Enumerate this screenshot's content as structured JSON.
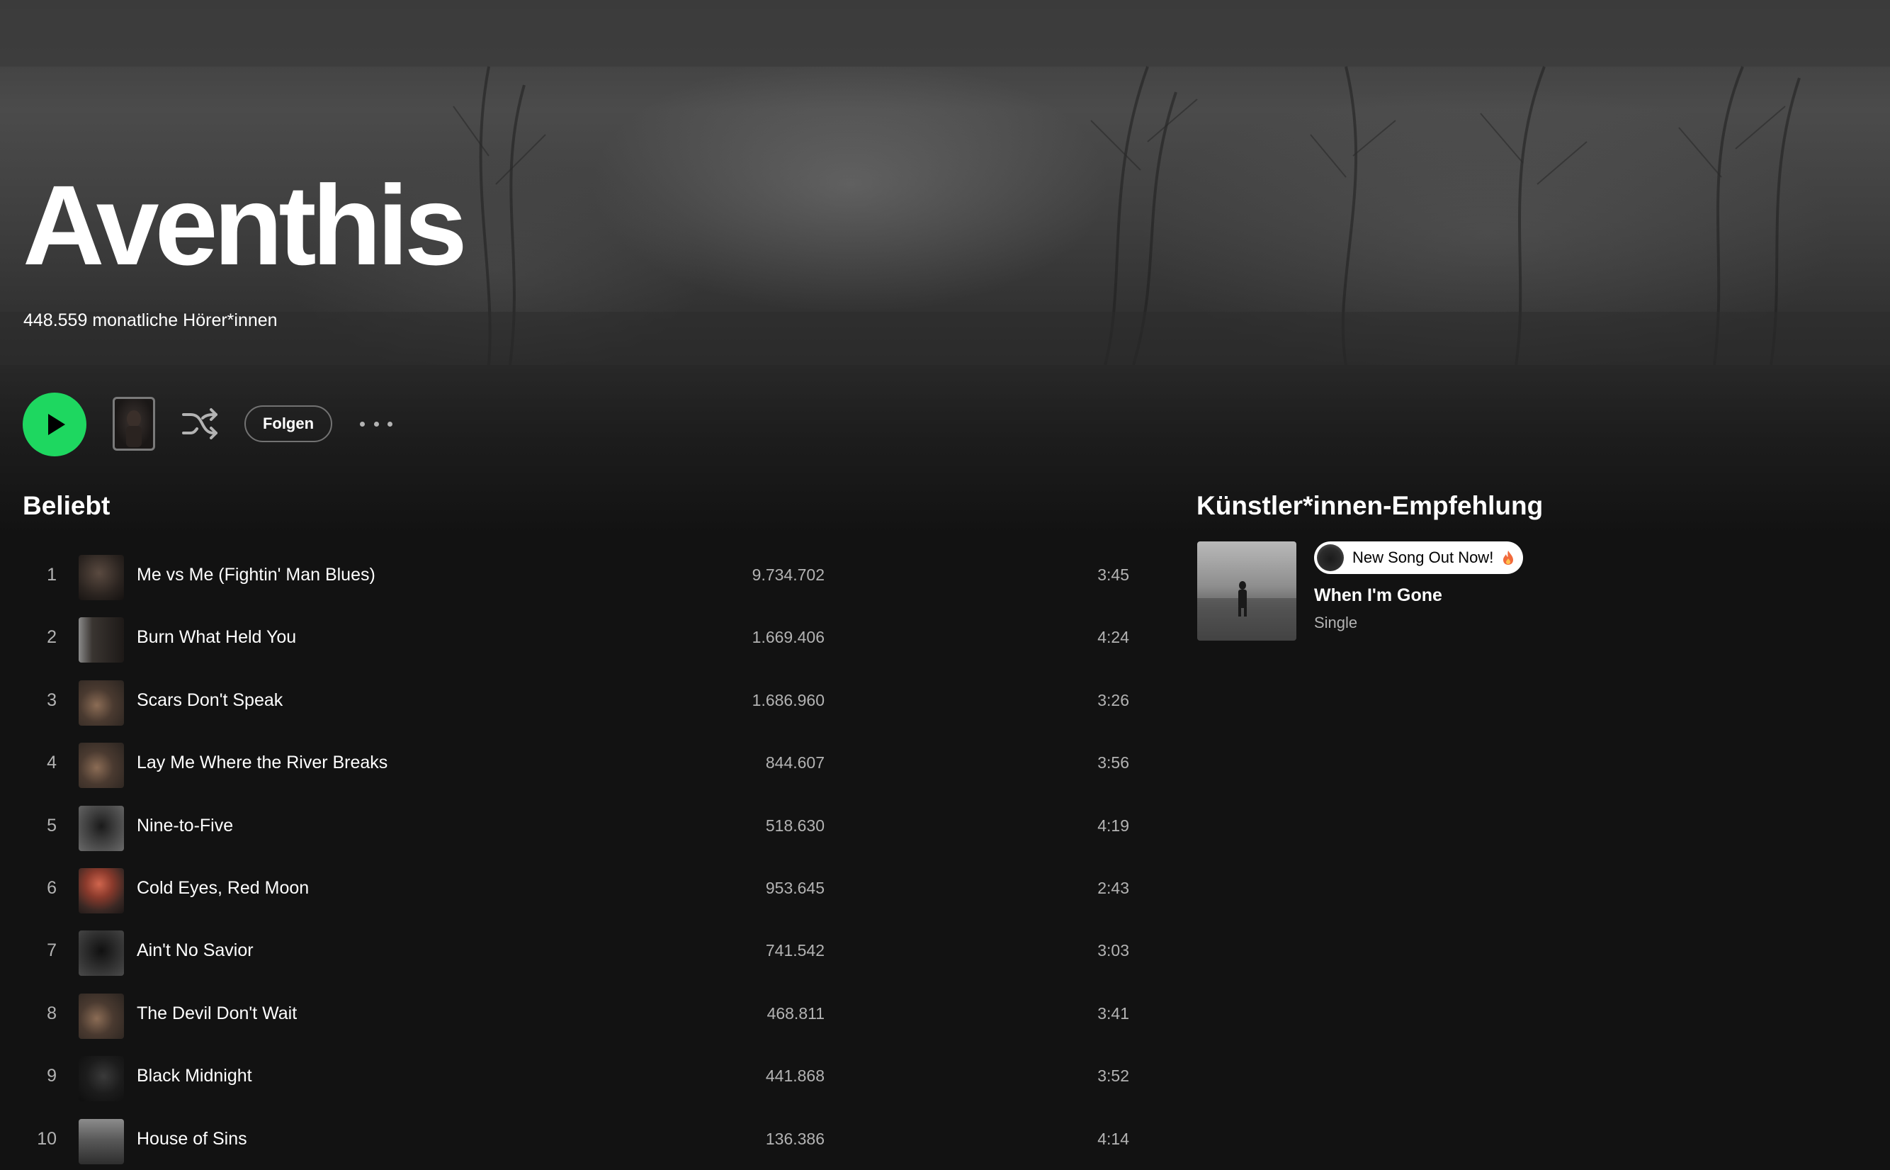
{
  "artist": {
    "name": "Aventhis",
    "monthly_listeners": "448.559 monatliche Hörer*innen"
  },
  "actions": {
    "play_label": "play-icon",
    "shuffle_icon": "shuffle-icon",
    "follow_label": "Folgen",
    "more_icon": "more-options-icon"
  },
  "popular": {
    "title": "Beliebt",
    "tracks": [
      {
        "num": "1",
        "title": "Me vs Me (Fightin' Man Blues)",
        "plays": "9.734.702",
        "duration": "3:45"
      },
      {
        "num": "2",
        "title": "Burn What Held You",
        "plays": "1.669.406",
        "duration": "4:24"
      },
      {
        "num": "3",
        "title": "Scars Don't Speak",
        "plays": "1.686.960",
        "duration": "3:26"
      },
      {
        "num": "4",
        "title": "Lay Me Where the River Breaks",
        "plays": "844.607",
        "duration": "3:56"
      },
      {
        "num": "5",
        "title": "Nine-to-Five",
        "plays": "518.630",
        "duration": "4:19"
      },
      {
        "num": "6",
        "title": "Cold Eyes, Red Moon",
        "plays": "953.645",
        "duration": "2:43"
      },
      {
        "num": "7",
        "title": "Ain't No Savior",
        "plays": "741.542",
        "duration": "3:03"
      },
      {
        "num": "8",
        "title": "The Devil Don't Wait",
        "plays": "468.811",
        "duration": "3:41"
      },
      {
        "num": "9",
        "title": "Black Midnight",
        "plays": "441.868",
        "duration": "3:52"
      },
      {
        "num": "10",
        "title": "House of Sins",
        "plays": "136.386",
        "duration": "4:14"
      }
    ]
  },
  "artist_pick": {
    "title": "Künstler*innen-Empfehlung",
    "badge": "New Song Out Now!",
    "name": "When I'm Gone",
    "type": "Single"
  },
  "colors": {
    "accent_green": "#1ed760",
    "background": "#121212",
    "secondary_text": "#b3b3b3"
  }
}
